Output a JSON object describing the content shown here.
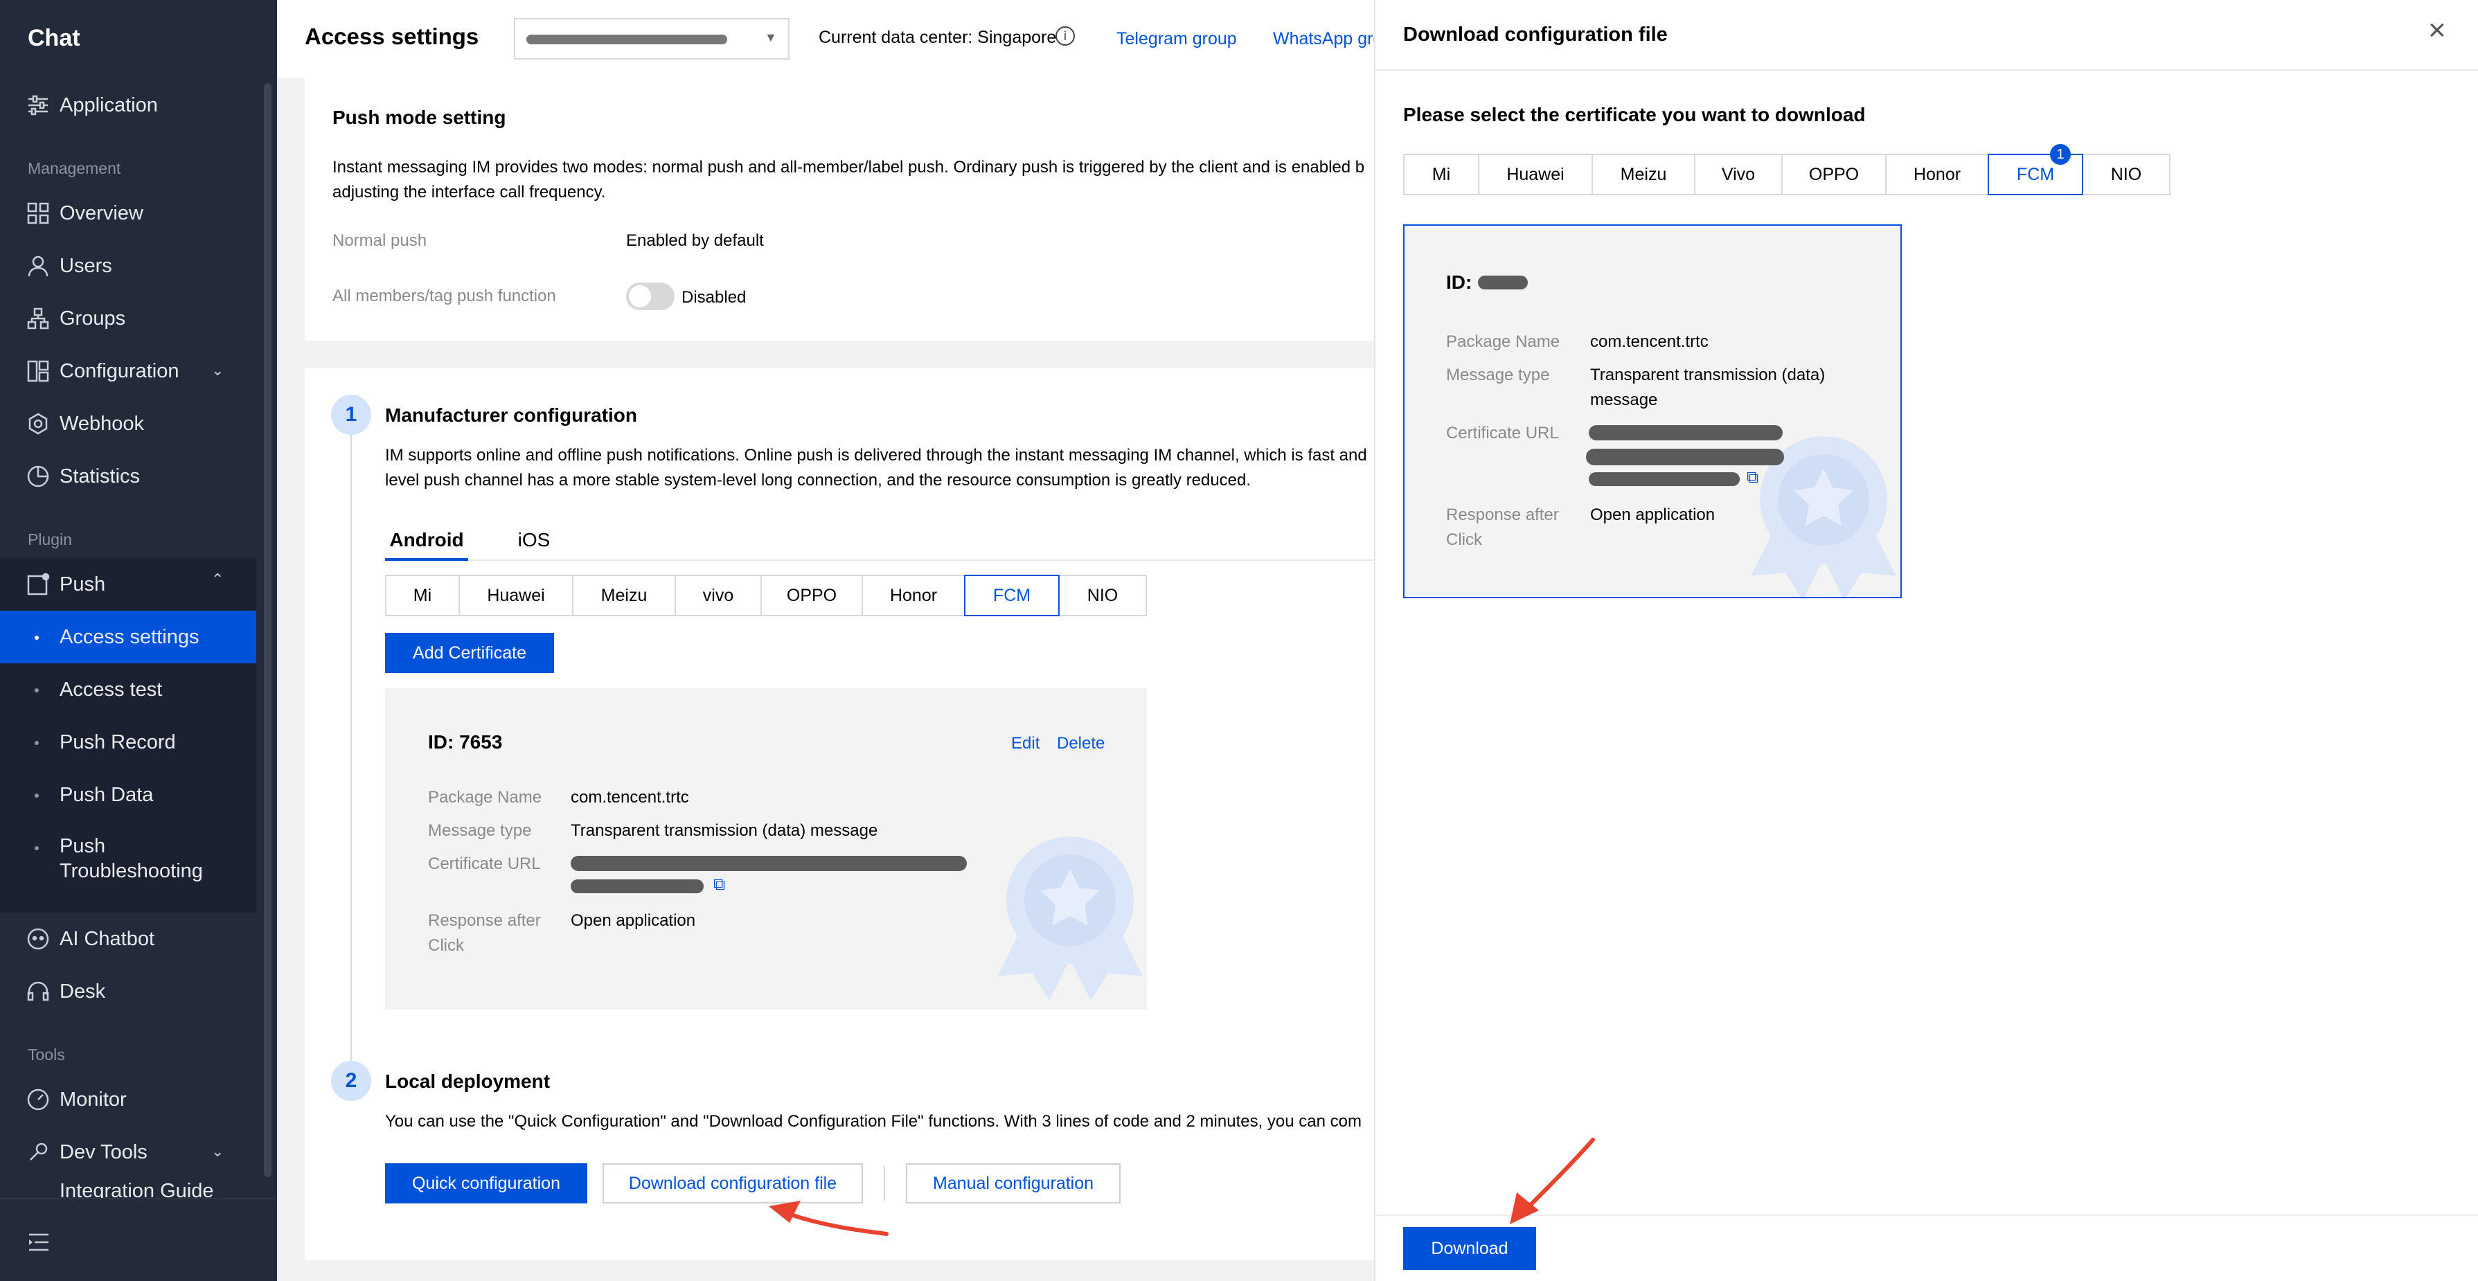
{
  "sidebar": {
    "app_title": "Chat",
    "application": "Application",
    "group_management": "Management",
    "overview": "Overview",
    "users": "Users",
    "groups": "Groups",
    "configuration": "Configuration",
    "webhook": "Webhook",
    "statistics": "Statistics",
    "group_plugin": "Plugin",
    "push": "Push",
    "push_items": [
      "Access settings",
      "Access test",
      "Push Record",
      "Push Data",
      "Push Troubleshooting"
    ],
    "ai_chatbot": "AI Chatbot",
    "desk": "Desk",
    "group_tools": "Tools",
    "monitor": "Monitor",
    "dev_tools": "Dev Tools",
    "integration_guide": "Integration Guide"
  },
  "header": {
    "title": "Access settings",
    "data_center": "Current data center: Singapore",
    "telegram": "Telegram group",
    "whatsapp": "WhatsApp gro"
  },
  "push_mode": {
    "title": "Push mode setting",
    "desc_line1": "Instant messaging IM provides two modes: normal push and all-member/label push. Ordinary push is triggered by the client and is enabled b",
    "desc_line2": "adjusting the interface call frequency.",
    "normal_label": "Normal push",
    "normal_value": "Enabled by default",
    "all_label": "All members/tag push function",
    "all_value": "Disabled"
  },
  "manufacturer": {
    "step": "1",
    "title": "Manufacturer configuration",
    "desc_line1": "IM supports online and offline push notifications. Online push is delivered through the instant messaging IM channel, which is fast and",
    "desc_line2": "level push channel has a more stable system-level long connection, and the resource consumption is greatly reduced.",
    "platform_tabs": [
      "Android",
      "iOS"
    ],
    "vendor_tabs": [
      "Mi",
      "Huawei",
      "Meizu",
      "vivo",
      "OPPO",
      "Honor",
      "FCM",
      "NIO"
    ],
    "add_certificate": "Add Certificate",
    "cert": {
      "id": "ID: 7653",
      "edit": "Edit",
      "delete": "Delete",
      "package_label": "Package Name",
      "package_value": "com.tencent.trtc",
      "msgtype_label": "Message type",
      "msgtype_value": "Transparent transmission (data) message",
      "url_label": "Certificate URL",
      "response_label": "Response after Click",
      "response_value": "Open application"
    }
  },
  "local": {
    "step": "2",
    "title": "Local deployment",
    "desc": "You can use the \"Quick Configuration\" and \"Download Configuration File\" functions. With 3 lines of code and 2 minutes, you can com",
    "quick": "Quick configuration",
    "download_file": "Download configuration file",
    "manual": "Manual configuration"
  },
  "drawer": {
    "title": "Download configuration file",
    "subtitle": "Please select the certificate you want to download",
    "vendor_tabs": [
      "Mi",
      "Huawei",
      "Meizu",
      "Vivo",
      "OPPO",
      "Honor",
      "FCM",
      "NIO"
    ],
    "badge": "1",
    "card": {
      "id_prefix": "ID:",
      "package_label": "Package Name",
      "package_value": "com.tencent.trtc",
      "msgtype_label": "Message type",
      "msgtype_value_line1": "Transparent transmission (data)",
      "msgtype_value_line2": "message",
      "url_label": "Certificate URL",
      "response_label": "Response after Click",
      "response_value": "Open application"
    },
    "download": "Download"
  }
}
